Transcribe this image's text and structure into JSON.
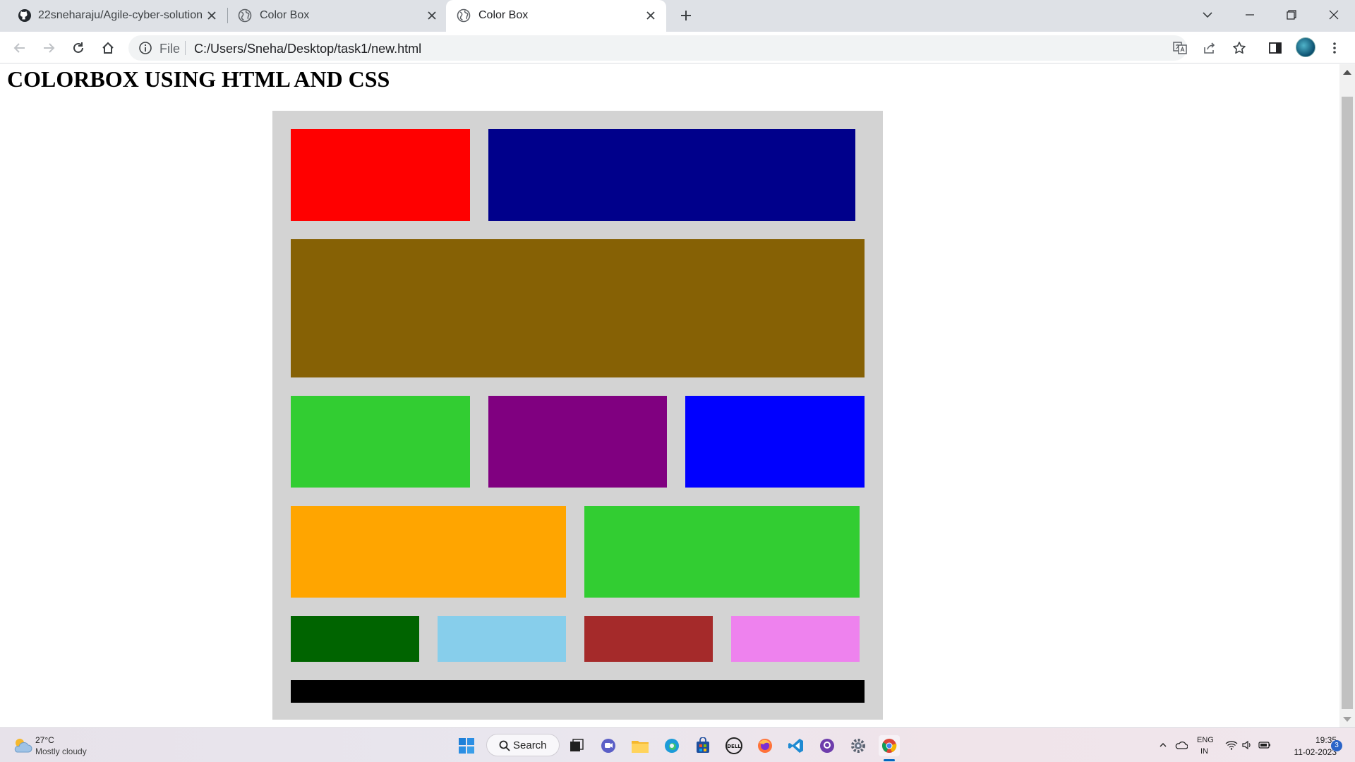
{
  "browser": {
    "tabs": [
      {
        "title": "22sneharaju/Agile-cyber-solution",
        "icon": "github-icon",
        "active": false
      },
      {
        "title": "Color Box",
        "icon": "globe-icon",
        "active": false
      },
      {
        "title": "Color Box",
        "icon": "globe-icon",
        "active": true
      }
    ],
    "address": {
      "scheme_label": "File",
      "url": "C:/Users/Sneha/Desktop/task1/new.html"
    }
  },
  "page": {
    "heading": "COLORBOX USING HTML AND CSS",
    "container_color": "#d3d3d3",
    "boxes": [
      {
        "name": "red-box",
        "color": "#ff0000"
      },
      {
        "name": "navy-box",
        "color": "#00008b"
      },
      {
        "name": "olive-brown-box",
        "color": "#866105"
      },
      {
        "name": "lime-green-box",
        "color": "#32cd32"
      },
      {
        "name": "purple-box",
        "color": "#800080"
      },
      {
        "name": "blue-box",
        "color": "#0000ff"
      },
      {
        "name": "orange-box",
        "color": "#ffa500"
      },
      {
        "name": "lime-green-box-2",
        "color": "#32cd32"
      },
      {
        "name": "dark-green-box",
        "color": "#006400"
      },
      {
        "name": "sky-blue-box",
        "color": "#87ceeb"
      },
      {
        "name": "brown-box",
        "color": "#a52a2a"
      },
      {
        "name": "violet-box",
        "color": "#ee82ee"
      },
      {
        "name": "black-bar",
        "color": "#000000"
      }
    ]
  },
  "taskbar": {
    "weather_temp": "27°C",
    "weather_desc": "Mostly cloudy",
    "search_label": "Search",
    "lang_top": "ENG",
    "lang_bottom": "IN",
    "time": "19:35",
    "date": "11-02-2023",
    "notification_count": "3"
  }
}
